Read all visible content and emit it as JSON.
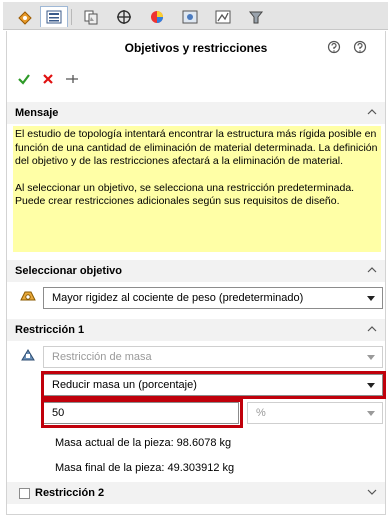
{
  "panel": {
    "title": "Objetivos y restricciones",
    "tabs": [
      "feature-manager-icon",
      "property-manager-icon",
      "configuration-manager-icon",
      "dimxpert-icon",
      "display-manager-icon",
      "cam-icon",
      "camera-icon",
      "topology-icon"
    ],
    "help_icons": [
      "help-question-icon",
      "help-circle-icon"
    ]
  },
  "actions": {
    "ok": "ok",
    "cancel": "cancel",
    "pin": "pin"
  },
  "message": {
    "heading": "Mensaje",
    "paragraph1": "El estudio de topología intentará encontrar la estructura más rígida posible en función de una cantidad de eliminación de material determinada. La definición del objetivo y de las restricciones afectará a la eliminación de material.",
    "paragraph2": "Al seleccionar un objetivo, se selecciona una restricción predeterminada. Puede crear restricciones adicionales según sus requisitos de diseño."
  },
  "objective": {
    "heading": "Seleccionar objetivo",
    "selected": "Mayor rigidez al cociente de peso (predeterminado)"
  },
  "constraint1": {
    "heading": "Restricción 1",
    "type": "Restricción de masa",
    "mode": "Reducir masa un (porcentaje)",
    "value": "50",
    "unit": "%",
    "current_mass": "Masa actual de la pieza: 98.6078 kg",
    "final_mass": "Masa final de la pieza: 49.303912 kg"
  },
  "constraint2": {
    "heading": "Restricción 2"
  },
  "colors": {
    "accent_red": "#c0000b",
    "message_bg": "#ffffa6",
    "ok_green": "#2e9a28",
    "cancel_red": "#e01010"
  }
}
